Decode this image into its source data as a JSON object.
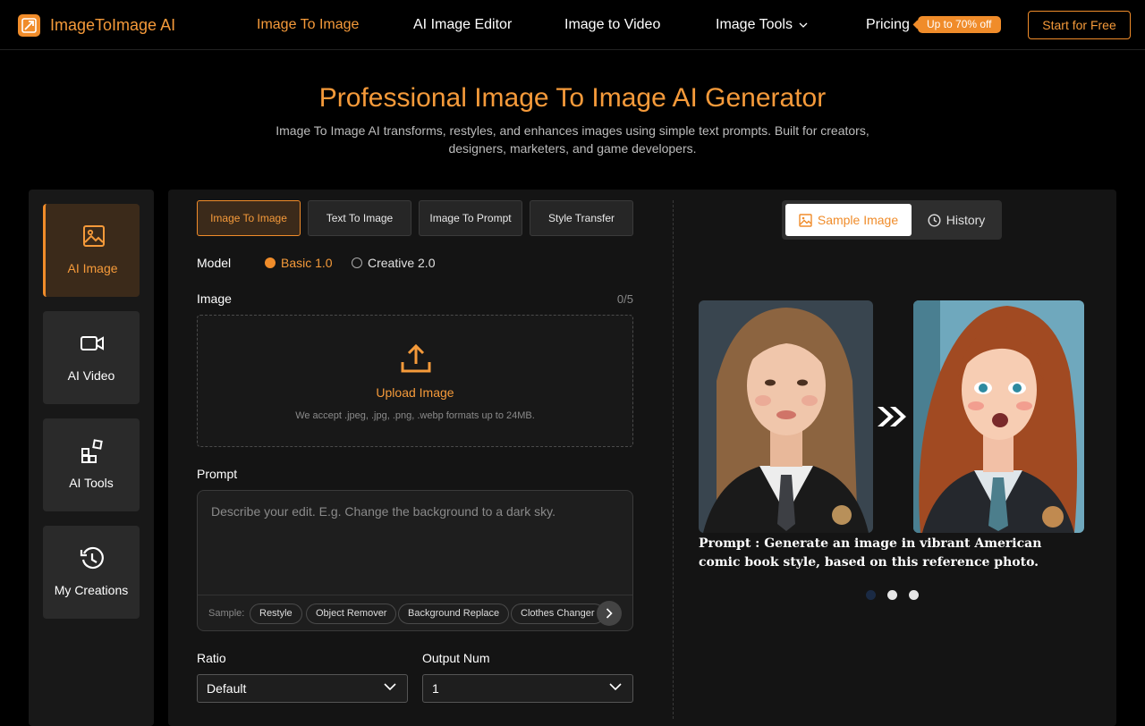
{
  "nav": {
    "brand": "ImageToImage AI",
    "links": [
      "Image To Image",
      "AI Image Editor",
      "Image to Video",
      "Image Tools",
      "Pricing"
    ],
    "badge": "Up to 70% off",
    "cta": "Start for Free"
  },
  "hero": {
    "title": "Professional Image To Image AI Generator",
    "subtitle": "Image To Image AI transforms, restyles, and enhances images using simple text prompts. Built for creators, designers, marketers, and game developers."
  },
  "sidebar": {
    "items": [
      {
        "label": "AI Image",
        "icon": "image-icon"
      },
      {
        "label": "AI Video",
        "icon": "video-icon"
      },
      {
        "label": "AI Tools",
        "icon": "tools-icon"
      },
      {
        "label": "My Creations",
        "icon": "history-icon"
      }
    ]
  },
  "tabs": [
    "Image To Image",
    "Text To Image",
    "Image To Prompt",
    "Style Transfer"
  ],
  "model": {
    "label": "Model",
    "options": [
      "Basic 1.0",
      "Creative 2.0"
    ],
    "selected": "Basic 1.0"
  },
  "image": {
    "label": "Image",
    "count": "0/5",
    "upload_label": "Upload Image",
    "upload_hint": "We accept .jpeg, .jpg, .png, .webp formats up to 24MB."
  },
  "prompt": {
    "label": "Prompt",
    "placeholder": "Describe your edit. E.g. Change the background to a dark sky.",
    "sample_label": "Sample:",
    "samples": [
      "Restyle",
      "Object Remover",
      "Background Replace",
      "Clothes Changer"
    ]
  },
  "ratio": {
    "label": "Ratio",
    "value": "Default"
  },
  "output": {
    "label": "Output Num",
    "value": "1"
  },
  "preview": {
    "toggles": [
      "Sample Image",
      "History"
    ],
    "caption": "Prompt : Generate an image in vibrant American comic book style, based on this reference photo.",
    "slide_count": 3,
    "active_slide": 0
  },
  "colors": {
    "accent": "#f08c2a",
    "background": "#000000",
    "panel": "#141414"
  }
}
